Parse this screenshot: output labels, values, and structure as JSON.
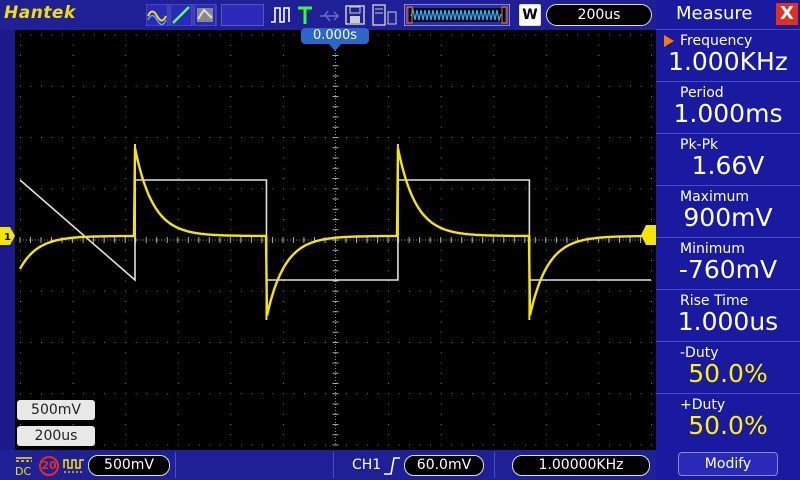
{
  "brand": "Hantek",
  "top": {
    "mode_w_label": "W",
    "timebase": "200us"
  },
  "screen": {
    "trigger_position": "0.000s",
    "ch1_scale": "500mV",
    "time_scale": "200us"
  },
  "bottom": {
    "dc_label": "DC",
    "bw_limit": "20",
    "ch1_volts": "500mV",
    "trigger_source": "CH1",
    "trigger_level": "60.0mV",
    "frequency": "1.00000KHz"
  },
  "panel": {
    "title": "Measure",
    "close": "X",
    "modify_label": "Modify",
    "items": [
      {
        "label": "Frequency",
        "value": "1.000KHz"
      },
      {
        "label": "Period",
        "value": "1.000ms"
      },
      {
        "label": "Pk-Pk",
        "value": "1.66V"
      },
      {
        "label": "Maximum",
        "value": "900mV"
      },
      {
        "label": "Minimum",
        "value": "-760mV"
      },
      {
        "label": "Rise Time",
        "value": "1.000us"
      },
      {
        "label": "-Duty",
        "value": "50.0%"
      },
      {
        "label": "+Duty",
        "value": "50.0%"
      }
    ]
  },
  "colors": {
    "ch1_trace": "#f5e600",
    "ref_trace": "#e0e0e0",
    "panel_bg": "#1a1aa0",
    "accent": "#2b66c8"
  }
}
